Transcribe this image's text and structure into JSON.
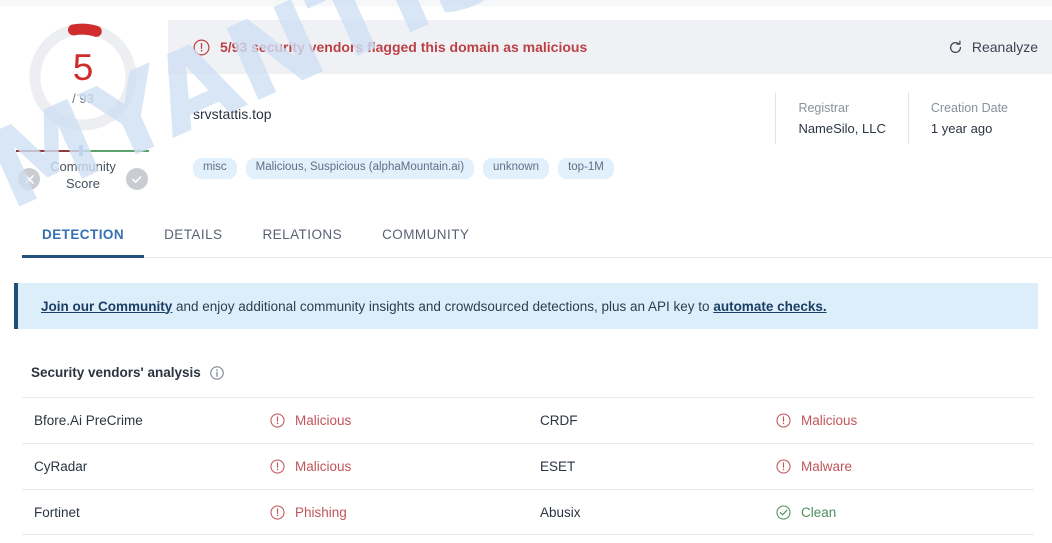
{
  "score": {
    "value": "5",
    "total": "/ 93",
    "community_label_line1": "Community",
    "community_label_line2": "Score",
    "donut_color": "#d12d2d",
    "donut_track": "#eceef1"
  },
  "alert": {
    "icon": "exclamation-circle-icon",
    "text": "5/93 security vendors flagged this domain as malicious",
    "color": "#bb4147",
    "reanalyze_label": "Reanalyze",
    "reanalyze_icon": "refresh-icon"
  },
  "domain": {
    "name": "srvstattis.top",
    "meta": [
      {
        "key": "Registrar",
        "value": "NameSilo, LLC"
      },
      {
        "key": "Creation Date",
        "value": "1 year ago"
      }
    ],
    "tags": [
      "misc",
      "Malicious, Suspicious (alphaMountain.ai)",
      "unknown",
      "top-1M"
    ]
  },
  "tabs": [
    {
      "label": "DETECTION",
      "active": true
    },
    {
      "label": "DETAILS",
      "active": false
    },
    {
      "label": "RELATIONS",
      "active": false
    },
    {
      "label": "COMMUNITY",
      "active": false
    }
  ],
  "community_banner": {
    "link1": "Join our Community",
    "middle": " and enjoy additional community insights and crowdsourced detections, plus an API key to ",
    "link2": "automate checks.",
    "background": "#ddeefb",
    "accent": "#1f4f74"
  },
  "vendors_section": {
    "title": "Security vendors' analysis",
    "info_icon": "info-circle-icon",
    "rows": [
      {
        "left": {
          "vendor": "Bfore.Ai PreCrime",
          "verdict": "Malicious",
          "state": "bad"
        },
        "right": {
          "vendor": "CRDF",
          "verdict": "Malicious",
          "state": "bad"
        }
      },
      {
        "left": {
          "vendor": "CyRadar",
          "verdict": "Malicious",
          "state": "bad"
        },
        "right": {
          "vendor": "ESET",
          "verdict": "Malware",
          "state": "bad"
        }
      },
      {
        "left": {
          "vendor": "Fortinet",
          "verdict": "Phishing",
          "state": "bad"
        },
        "right": {
          "vendor": "Abusix",
          "verdict": "Clean",
          "state": "good"
        }
      }
    ]
  },
  "watermark": {
    "text": "MYANTISPYWARE.COM",
    "color": "#cfe0f5"
  }
}
